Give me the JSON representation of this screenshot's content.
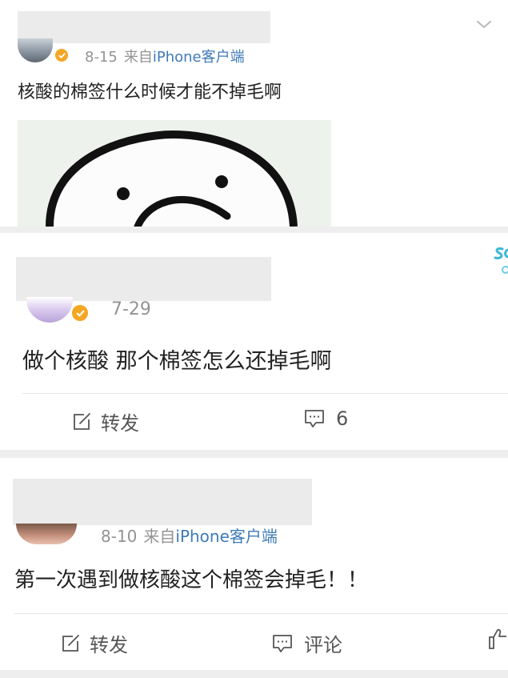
{
  "posts": [
    {
      "date": "8-15",
      "source_prefix": "来自",
      "client": "iPhone客户端",
      "text": "核酸的棉签什么时候才能不掉毛啊"
    },
    {
      "date": "7-29",
      "text": "做个核酸 那个棉签怎么还掉毛啊",
      "actions": {
        "repost": "转发",
        "comment_count": "6"
      }
    },
    {
      "date": "8-10",
      "source_prefix": "来自",
      "client": "iPhone客户端",
      "text": "第一次遇到做核酸这个棉签会掉毛！！",
      "actions": {
        "repost": "转发",
        "comment": "评论"
      }
    }
  ],
  "colors": {
    "page_bg": "#eeeeee",
    "card_bg": "#ffffff",
    "meta_gray": "#939393",
    "client_blue": "#3f7ab8",
    "verified_orange": "#f5a623"
  }
}
